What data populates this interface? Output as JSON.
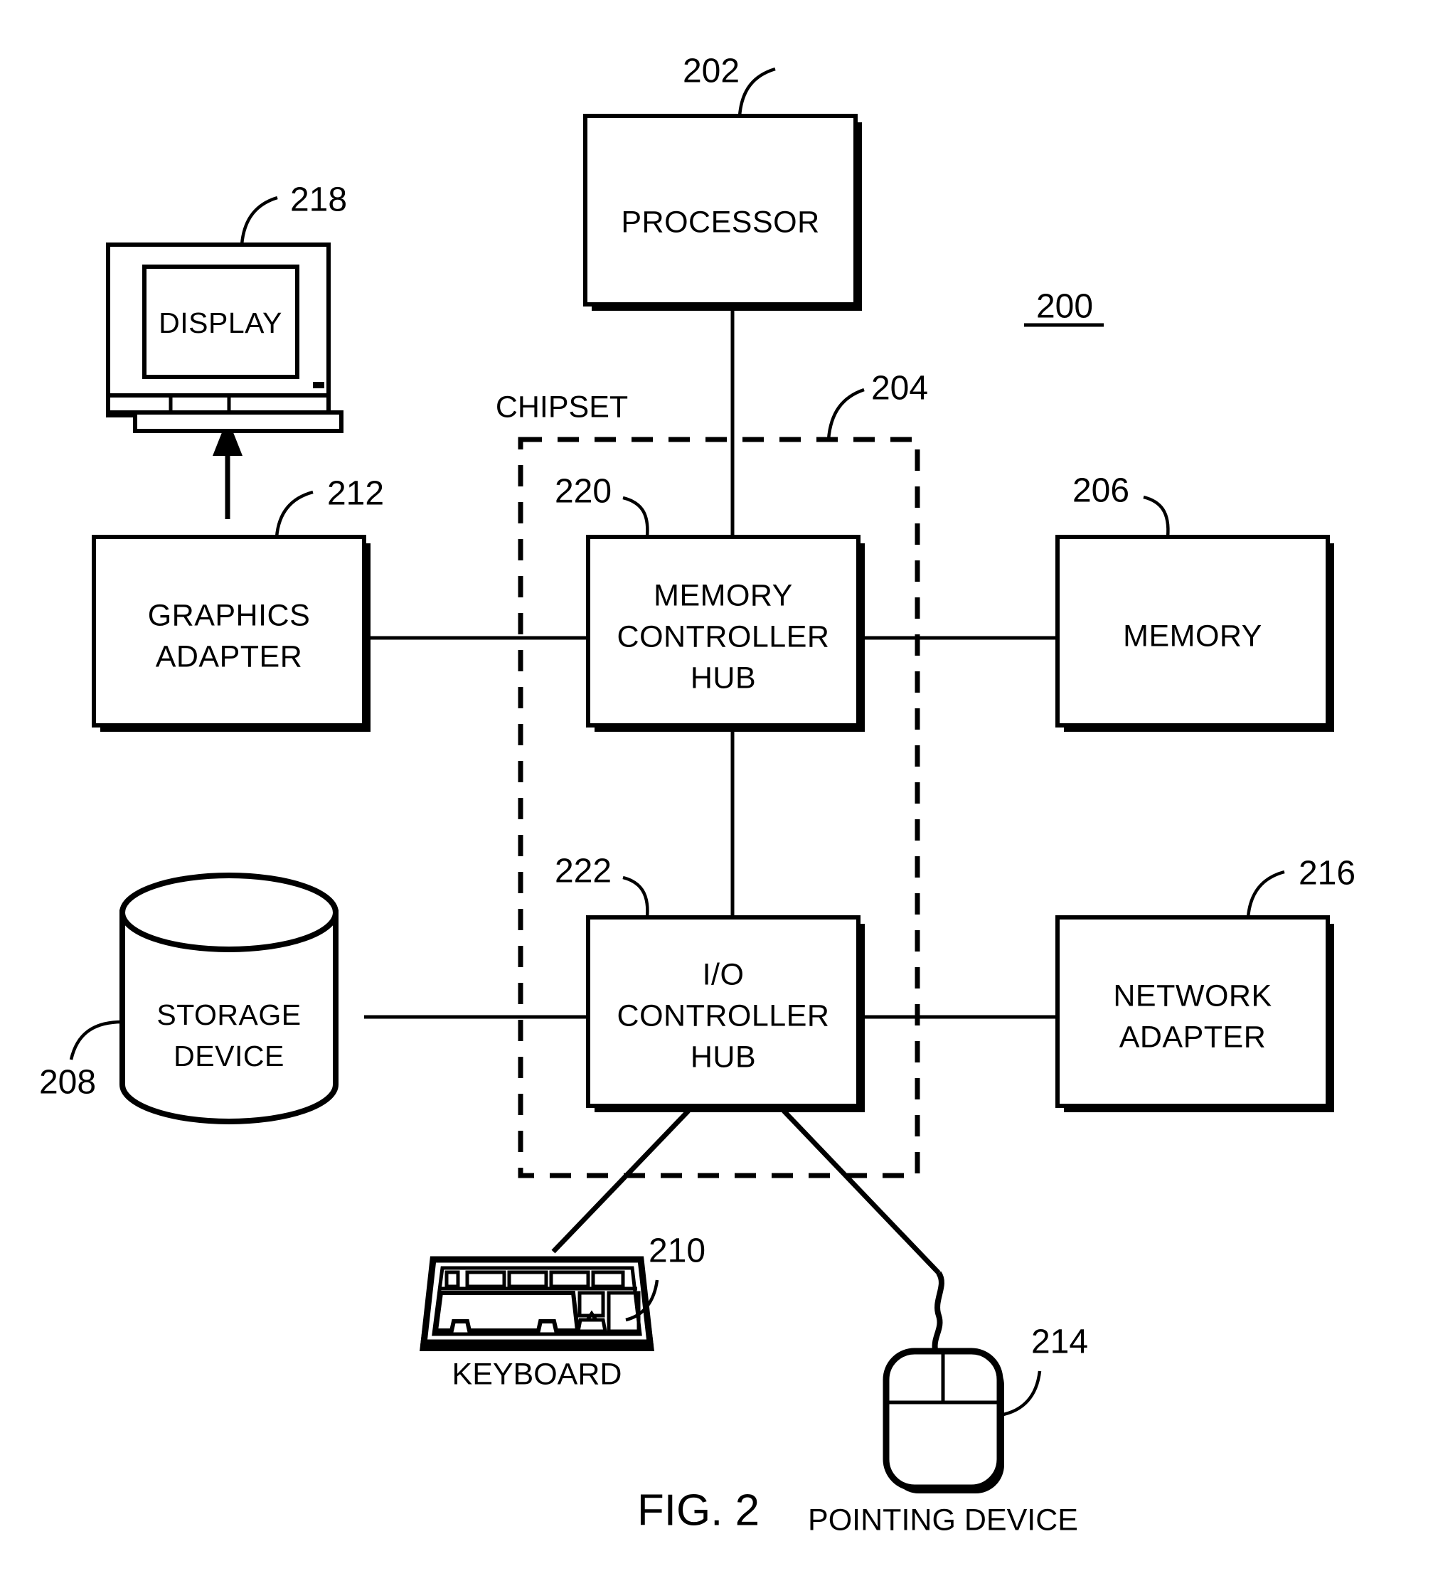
{
  "figure": {
    "caption": "FIG. 2",
    "system_ref": "200"
  },
  "blocks": [
    {
      "id": "processor",
      "lines": [
        "PROCESSOR"
      ],
      "ref": "202"
    },
    {
      "id": "memory-controller-hub",
      "lines": [
        "MEMORY",
        "CONTROLLER",
        "HUB"
      ],
      "ref": "220"
    },
    {
      "id": "memory",
      "lines": [
        "MEMORY"
      ],
      "ref": "206"
    },
    {
      "id": "graphics-adapter",
      "lines": [
        "GRAPHICS",
        "ADAPTER"
      ],
      "ref": "212"
    },
    {
      "id": "io-controller-hub",
      "lines": [
        "I/O",
        "CONTROLLER",
        "HUB"
      ],
      "ref": "222"
    },
    {
      "id": "network-adapter",
      "lines": [
        "NETWORK",
        "ADAPTER"
      ],
      "ref": "216"
    }
  ],
  "devices": [
    {
      "id": "display",
      "label": "DISPLAY",
      "ref": "218"
    },
    {
      "id": "storage-device",
      "lines": [
        "STORAGE",
        "DEVICE"
      ],
      "ref": "208"
    },
    {
      "id": "keyboard",
      "label": "KEYBOARD",
      "ref": "210"
    },
    {
      "id": "pointing-device",
      "label": "POINTING DEVICE",
      "ref": "214"
    }
  ],
  "chipset": {
    "label": "CHIPSET",
    "ref": "204"
  },
  "colors": {
    "ink": "#000000",
    "paper": "#ffffff"
  }
}
